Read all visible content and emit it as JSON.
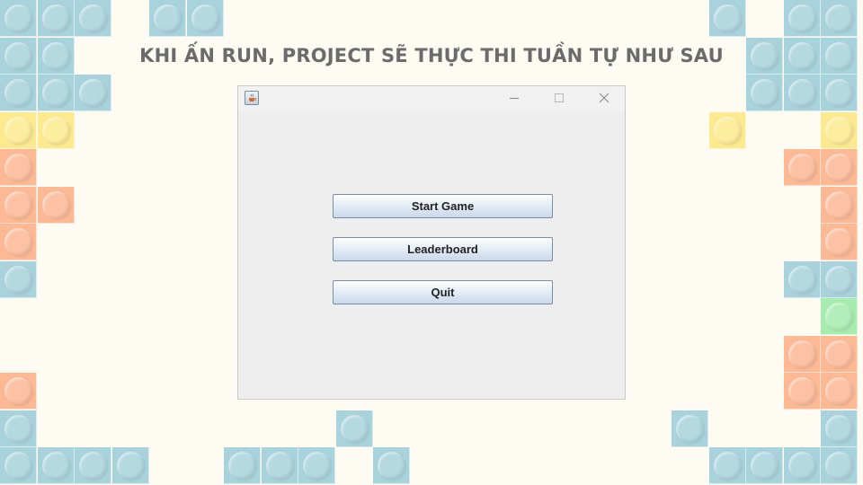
{
  "slide": {
    "heading": "KHI ẤN RUN, PROJECT SẼ THỰC THI TUẦN TỰ NHƯ SAU"
  },
  "colors": {
    "background": "#fefbf3",
    "brick_blue": "#a8d3dc",
    "brick_yellow": "#fdea8e",
    "brick_orange": "#fdb894",
    "brick_green": "#a6ecae"
  },
  "window": {
    "title": "",
    "icon": "java-coffee-icon",
    "controls": [
      "minimize-icon",
      "maximize-icon",
      "close-icon"
    ]
  },
  "menu": {
    "start_label": "Start Game",
    "leaderboard_label": "Leaderboard",
    "quit_label": "Quit"
  }
}
